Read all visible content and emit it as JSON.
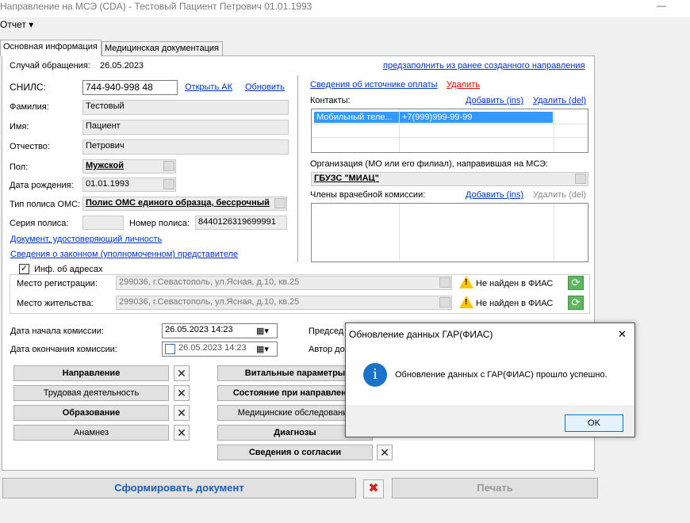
{
  "window": {
    "title": "Направление на МСЭ (CDA) - Тестовый Пациент Петрович 01.01.1993",
    "minimize": "—"
  },
  "menu": {
    "report": "Отчет ▾"
  },
  "tabs": [
    {
      "label": "Основная информация"
    },
    {
      "label": "Медицинская документация"
    }
  ],
  "case": {
    "label": "Случай обращения:",
    "date": "26.05.2023",
    "prefill_link": "предзаполнить из ранее созданного направления"
  },
  "patient": {
    "snils_label": "СНИЛС:",
    "snils": "744-940-998 48",
    "open_ak": "Открыть АК",
    "refresh": "Обновить",
    "surname_label": "Фамилия:",
    "surname": "Тестовый",
    "name_label": "Имя:",
    "name": "Пациент",
    "patronymic_label": "Отчество:",
    "patronymic": "Петрович",
    "sex_label": "Пол:",
    "sex": "Мужской",
    "birth_label": "Дата рождения:",
    "birth": "01.01.1993",
    "policy_type_label": "Тип полиса ОМС:",
    "policy_type": "Полис ОМС единого образца, бессрочный",
    "policy_series_label": "Серия полиса:",
    "policy_series": "",
    "policy_number_label": "Номер полиса:",
    "policy_number": "8440126319699991",
    "id_doc_link": "Документ, удостоверяющий личность",
    "legal_rep_link": "Сведения о законном (уполномоченном) представителе"
  },
  "right": {
    "payment_link": "Сведения об источнике оплаты",
    "delete_link": "Удалить",
    "contacts_label": "Контакты:",
    "add_ins": "Добавить (ins)",
    "delete_del": "Удалить (del)",
    "contacts": [
      {
        "type": "Мобильный теле...",
        "value": "+7(999)999-99-99"
      }
    ],
    "org_label": "Организация (МО или его филиал), направившая на МСЭ:",
    "org": "ГБУЗС \"МИАЦ\"",
    "commission_label": "Члены врачебной комиссии:",
    "commission_add": "Добавить (ins)",
    "commission_del": "Удалить (del)"
  },
  "addresses": {
    "checkbox_label": "Инф. об адресах",
    "checked": true,
    "check_mark": "✓",
    "reg_label": "Место регистрации:",
    "reg_value": "299036, г.Севастополь, ул.Ясная, д.10, кв.25",
    "live_label": "Место жительства:",
    "live_value": "299036, г.Севастополь, ул.Ясная, д.10, кв.25",
    "fias_status": "Не найден в ФИАС",
    "warn_glyph": "!",
    "refresh_glyph": "⟳"
  },
  "commission": {
    "start_label": "Дата начала комиссии:",
    "start_value": "26.05.2023 14:23",
    "end_label": "Дата окончания комиссии:",
    "end_value": "26.05.2023 14:23",
    "chair_label": "Председ",
    "author_label": "Автор до",
    "cal_glyph": "▦▾"
  },
  "sections": {
    "left": [
      "Направление",
      "Трудовая деятельность",
      "Образование",
      "Анамнез"
    ],
    "right": [
      "Витальные параметры",
      "Состояние при направлении",
      "Медицинские обследования",
      "Диагнозы",
      "Сведения о согласии"
    ],
    "x_glyph": "✕"
  },
  "footer": {
    "generate": "Сформировать документ",
    "print": "Печать",
    "cancel_glyph": "✖"
  },
  "dialog": {
    "title": "Обновление данных ГАР(ФИАС)",
    "close": "✕",
    "icon": "i",
    "message": "Обновление данных с ГАР(ФИАС) прошло успешно.",
    "ok": "OK"
  }
}
